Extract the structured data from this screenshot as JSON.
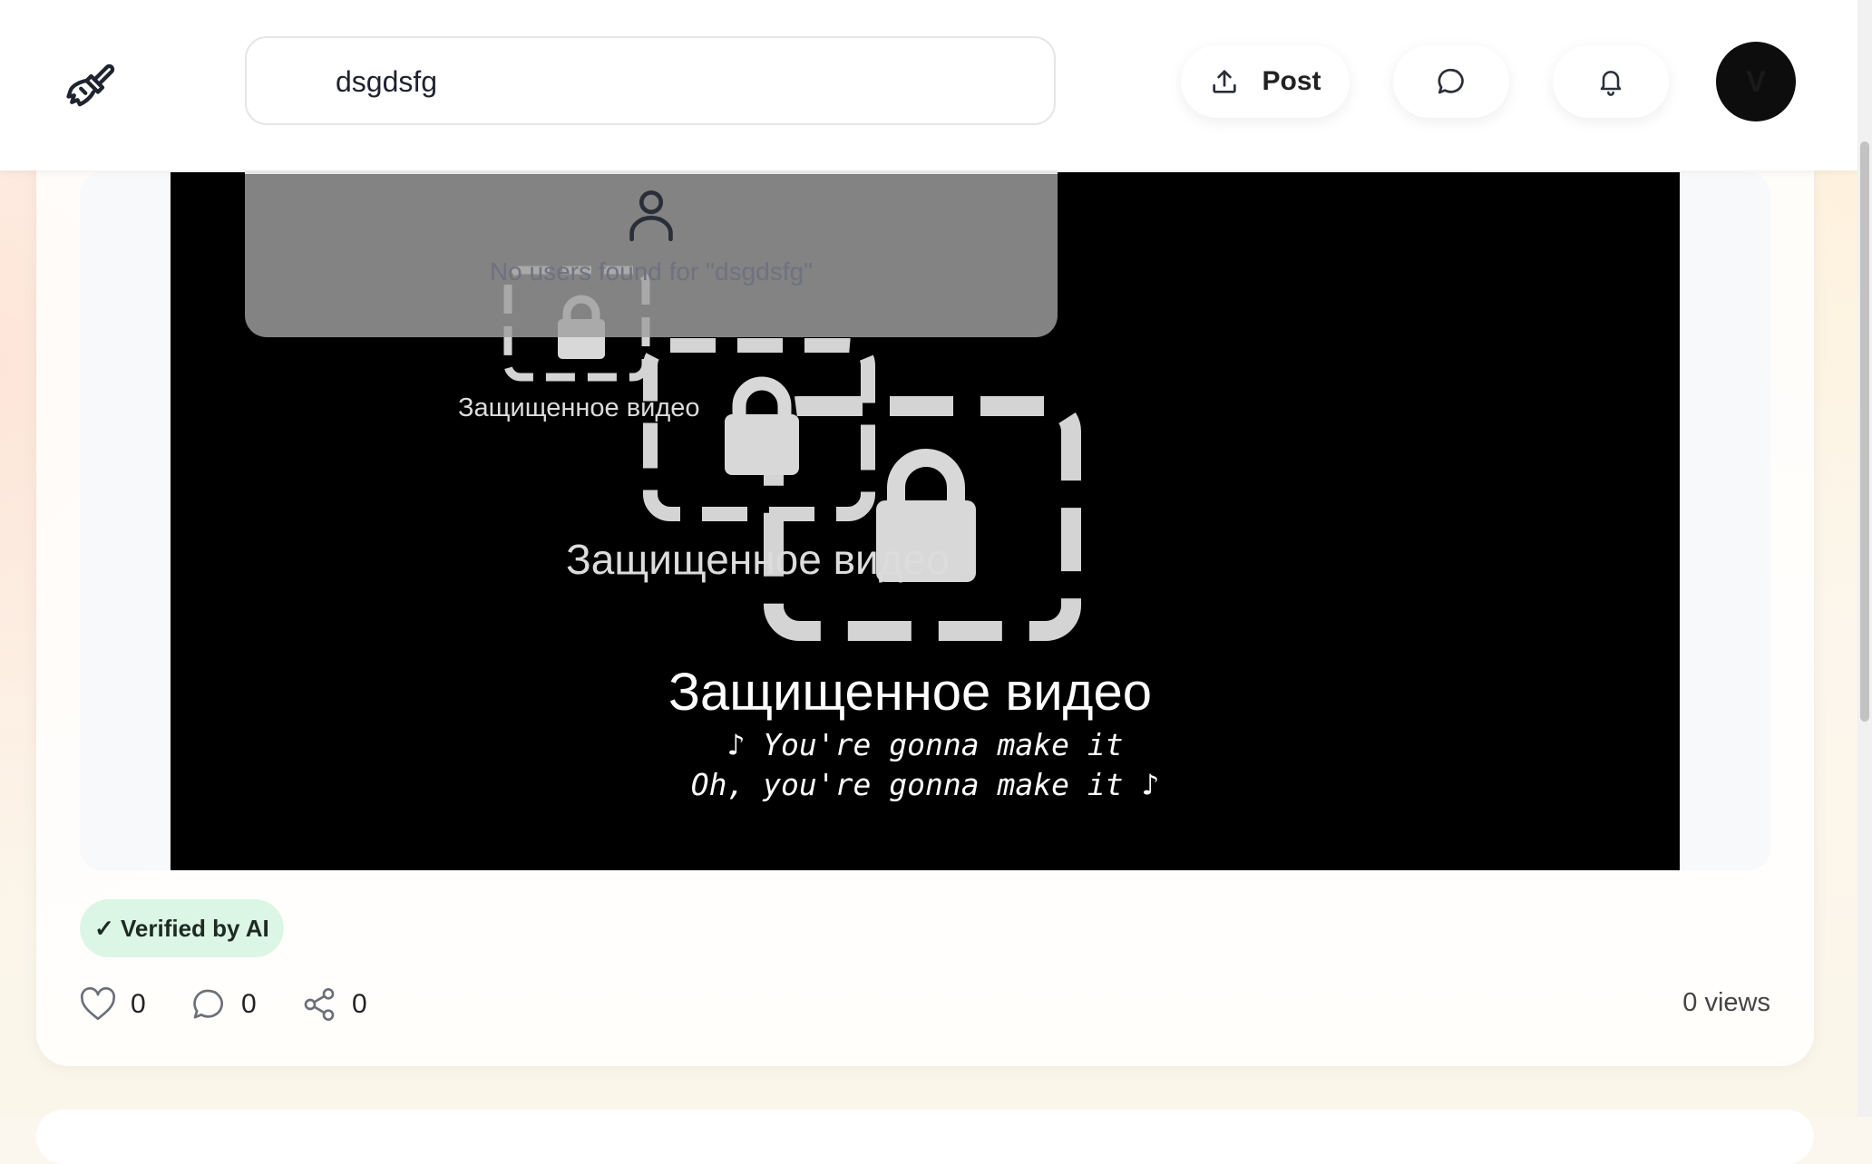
{
  "header": {
    "search": {
      "value": "dsgdsfg",
      "placeholder": ""
    },
    "post_label": "Post",
    "avatar_initial": "V"
  },
  "search_results": {
    "empty_message": "No users found for \"dsgdsfg\""
  },
  "post": {
    "video": {
      "overlay_label": "Защищенное видео",
      "caption_line1": "♪ You're gonna make it",
      "caption_line2": "Oh, you're gonna make it ♪"
    },
    "badge": "✓ Verified by AI",
    "likes": "0",
    "comments": "0",
    "shares": "0",
    "views": "0 views"
  },
  "colors": {
    "badge_bg": "#dcf6e6",
    "avatar_bg": "#0d0d0d",
    "video_bg": "#000000"
  },
  "icons": [
    "paintbrush-icon",
    "upload-icon",
    "chat-icon",
    "bell-icon",
    "user-icon",
    "lock-icon",
    "heart-icon",
    "comment-icon",
    "share-icon"
  ]
}
